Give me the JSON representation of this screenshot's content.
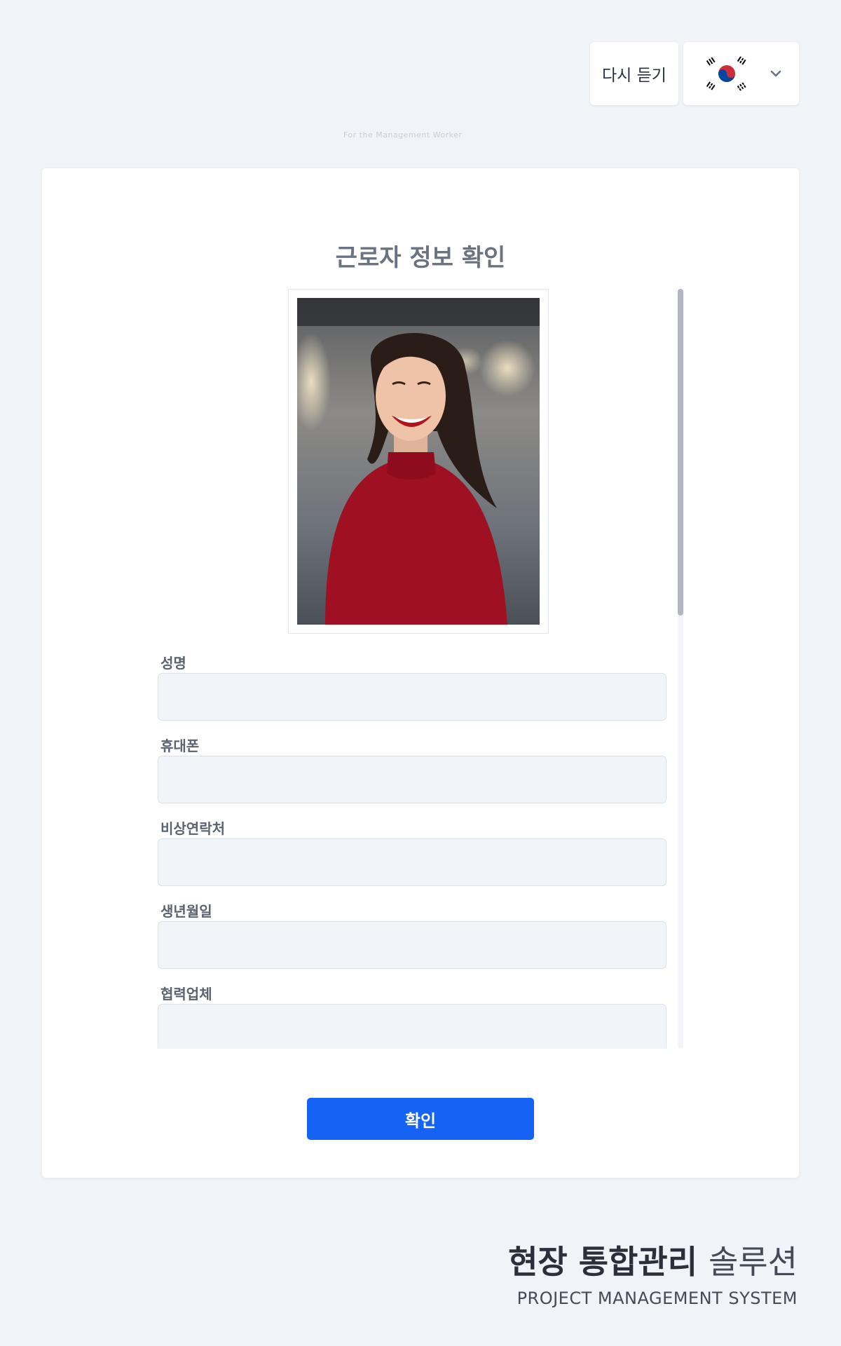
{
  "header": {
    "replay_label": "다시 듣기",
    "language": {
      "selected": "Korean",
      "flag_icon": "korea-flag-icon"
    },
    "faint_text": "For the Management Worker"
  },
  "form": {
    "title": "근로자 정보 확인",
    "photo_icon": "worker-photo",
    "fields": [
      {
        "label": "성명",
        "value": ""
      },
      {
        "label": "휴대폰",
        "value": ""
      },
      {
        "label": "비상연락처",
        "value": ""
      },
      {
        "label": "생년월일",
        "value": ""
      },
      {
        "label": "협력업체",
        "value": ""
      }
    ],
    "confirm_label": "확인"
  },
  "brand": {
    "title_bold": "현장 통합관리",
    "title_light": "솔루션",
    "subtitle": "PROJECT MANAGEMENT SYSTEM"
  },
  "colors": {
    "accent": "#1463f5",
    "background": "#f0f4f8",
    "input_bg": "#f1f4f8"
  }
}
